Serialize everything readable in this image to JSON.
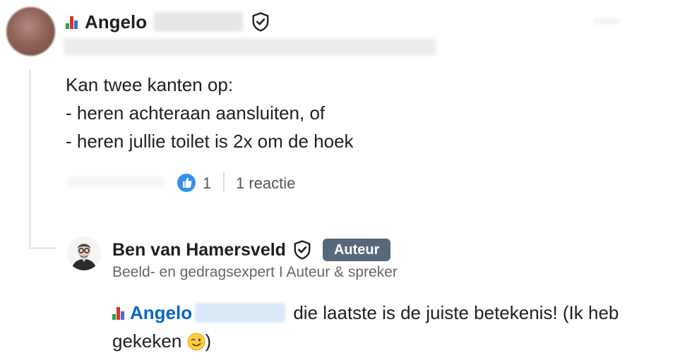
{
  "comment": {
    "author_first_name": "Angelo",
    "lines": [
      "Kan twee kanten op:",
      "- heren achteraan aansluiten, of",
      "- heren jullie toilet is 2x om de hoek"
    ],
    "like_count": "1",
    "reply_count_label": "1 reactie"
  },
  "reply": {
    "author_name": "Ben van Hamersveld",
    "badge": "Auteur",
    "headline": "Beeld- en gedragsexpert I Auteur & spreker",
    "mention_first_name": "Angelo",
    "text_after_mention": "die laatste is de juiste betekenis! (Ik heb",
    "text_line2": "gekeken",
    "text_line2_end": ")"
  },
  "icons": {
    "chart": "bar-chart-emoji-icon",
    "verified": "shield-check-icon",
    "like": "thumbs-up-reaction-icon",
    "wink": "winking-face-emoji-icon"
  },
  "colors": {
    "mention": "#0a66c2",
    "badge_bg": "#56687a",
    "thread_line": "#ece8e3",
    "like_blue": "#378fe9"
  }
}
